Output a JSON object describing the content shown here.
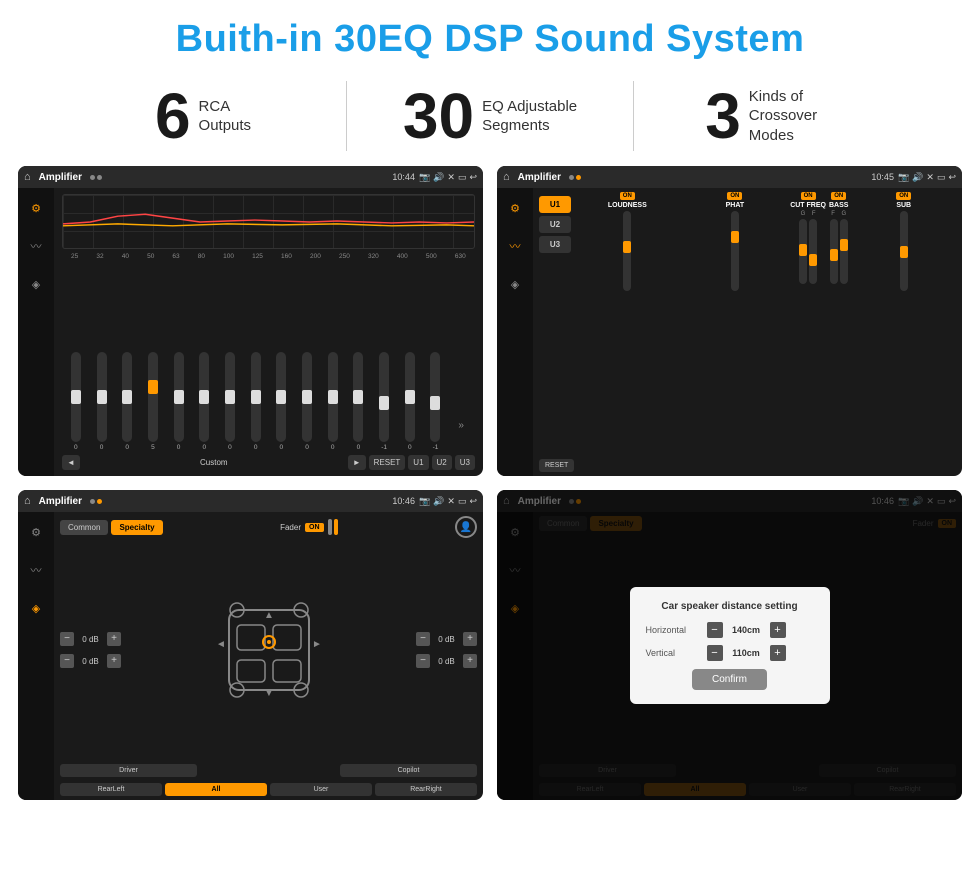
{
  "header": {
    "title": "Buith-in 30EQ DSP Sound System"
  },
  "stats": [
    {
      "number": "6",
      "text_line1": "RCA",
      "text_line2": "Outputs"
    },
    {
      "number": "30",
      "text_line1": "EQ Adjustable",
      "text_line2": "Segments"
    },
    {
      "number": "3",
      "text_line1": "Kinds of",
      "text_line2": "Crossover Modes"
    }
  ],
  "screens": [
    {
      "id": "eq-screen",
      "status_bar": {
        "title": "Amplifier",
        "time": "10:44"
      },
      "freq_labels": [
        "25",
        "32",
        "40",
        "50",
        "63",
        "80",
        "100",
        "125",
        "160",
        "200",
        "250",
        "320",
        "400",
        "500",
        "630"
      ],
      "slider_values": [
        "0",
        "0",
        "0",
        "5",
        "0",
        "0",
        "0",
        "0",
        "0",
        "0",
        "0",
        "0",
        "-1",
        "0",
        "-1"
      ],
      "bottom_labels": [
        "Custom",
        "RESET",
        "U1",
        "U2",
        "U3"
      ]
    },
    {
      "id": "crossover-screen",
      "status_bar": {
        "title": "Amplifier",
        "time": "10:45"
      },
      "presets": [
        "U1",
        "U2",
        "U3"
      ],
      "channels": [
        {
          "label": "LOUDNESS",
          "on": true
        },
        {
          "label": "PHAT",
          "on": true
        },
        {
          "label": "CUT FREQ",
          "on": true
        },
        {
          "label": "BASS",
          "on": true
        },
        {
          "label": "SUB",
          "on": true
        }
      ],
      "reset_label": "RESET"
    },
    {
      "id": "fader-screen",
      "status_bar": {
        "title": "Amplifier",
        "time": "10:46"
      },
      "tabs": [
        "Common",
        "Specialty"
      ],
      "fader_label": "Fader",
      "fader_on": "ON",
      "volume_rows": [
        {
          "label": "0 dB",
          "side": "left"
        },
        {
          "label": "0 dB",
          "side": "right-top"
        },
        {
          "label": "0 dB",
          "side": "left2"
        },
        {
          "label": "0 dB",
          "side": "right-bottom"
        }
      ],
      "bottom_nav": [
        "Driver",
        "",
        "Copilot",
        "RearLeft",
        "All",
        "User",
        "RearRight"
      ]
    },
    {
      "id": "dialog-screen",
      "status_bar": {
        "title": "Amplifier",
        "time": "10:46"
      },
      "tabs": [
        "Common",
        "Specialty"
      ],
      "fader_label": "Fader",
      "fader_on": "ON",
      "dialog": {
        "title": "Car speaker distance setting",
        "horizontal_label": "Horizontal",
        "horizontal_value": "140cm",
        "vertical_label": "Vertical",
        "vertical_value": "110cm",
        "confirm_label": "Confirm"
      },
      "bottom_nav": [
        "Driver",
        "Copilot",
        "RearLeft",
        "All",
        "User",
        "RearRight"
      ]
    }
  ]
}
